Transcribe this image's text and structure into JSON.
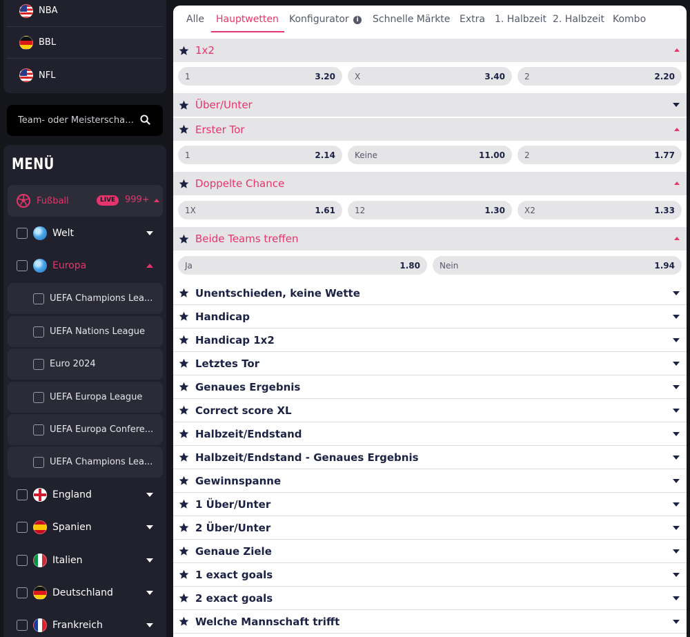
{
  "top_sports": [
    {
      "label": "NBA",
      "flag": "us"
    },
    {
      "label": "BBL",
      "flag": "de"
    },
    {
      "label": "NFL",
      "flag": "us"
    }
  ],
  "search": {
    "placeholder": "Team- oder Meisterschaf..."
  },
  "menu": {
    "title": "MENÜ",
    "sport": {
      "label": "Fußball",
      "live": "LIVE",
      "count": "999+"
    },
    "regions_top": [
      {
        "label": "Welt",
        "icon": "globe-icon",
        "expanded": false
      },
      {
        "label": "Europa",
        "icon": "globe-icon",
        "expanded": true
      }
    ],
    "leagues": [
      {
        "label": "UEFA Champions Lea..."
      },
      {
        "label": "UEFA Nations League"
      },
      {
        "label": "Euro 2024"
      },
      {
        "label": "UEFA Europa League"
      },
      {
        "label": "UEFA Europa Confere..."
      },
      {
        "label": "UEFA Champions Lea..."
      }
    ],
    "countries": [
      {
        "label": "England",
        "flag": "en"
      },
      {
        "label": "Spanien",
        "flag": "es"
      },
      {
        "label": "Italien",
        "flag": "it"
      },
      {
        "label": "Deutschland",
        "flag": "de"
      },
      {
        "label": "Frankreich",
        "flag": "fr"
      }
    ]
  },
  "tabs": [
    {
      "label": "Alle"
    },
    {
      "label": "Hauptwetten",
      "active": true
    },
    {
      "label": "Konfigurator"
    },
    {
      "label": "Schnelle Märkte"
    },
    {
      "label": "Extra"
    },
    {
      "label": "1. Halbzeit"
    },
    {
      "label": "2. Halbzeit"
    },
    {
      "label": "Kombo"
    }
  ],
  "info_glyph": "i",
  "markets_expanded": [
    {
      "title": "1x2",
      "odds": [
        {
          "name": "1",
          "value": "3.20"
        },
        {
          "name": "X",
          "value": "3.40"
        },
        {
          "name": "2",
          "value": "2.20"
        }
      ]
    },
    {
      "title": "Über/Unter",
      "collapsed": true
    },
    {
      "title": "Erster Tor",
      "odds": [
        {
          "name": "1",
          "value": "2.14"
        },
        {
          "name": "Keine",
          "value": "11.00"
        },
        {
          "name": "2",
          "value": "1.77"
        }
      ]
    },
    {
      "title": "Doppelte Chance",
      "odds": [
        {
          "name": "1X",
          "value": "1.61"
        },
        {
          "name": "12",
          "value": "1.30"
        },
        {
          "name": "X2",
          "value": "1.33"
        }
      ]
    },
    {
      "title": "Beide Teams treffen",
      "odds": [
        {
          "name": "Ja",
          "value": "1.80"
        },
        {
          "name": "Nein",
          "value": "1.94"
        }
      ]
    }
  ],
  "markets_collapsed": [
    "Unentschieden, keine Wette",
    "Handicap",
    "Handicap 1x2",
    "Letztes Tor",
    "Genaues Ergebnis",
    "Correct score XL",
    "Halbzeit/Endstand",
    "Halbzeit/Endstand - Genaues Ergebnis",
    "Gewinnspanne",
    "1 Über/Unter",
    "2 Über/Unter",
    "Genaue Ziele",
    "1 exact goals",
    "2 exact goals",
    "Welche Mannschaft trifft"
  ],
  "colors": {
    "accent": "#e8346c",
    "navy": "#1b2244",
    "sidebar": "#20212c"
  }
}
